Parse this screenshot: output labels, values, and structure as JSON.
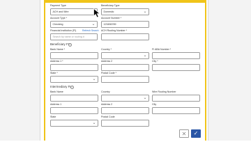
{
  "payment": {
    "payment_type": {
      "label": "Payment Type",
      "value": "ACH and Wire"
    },
    "beneficiary_type": {
      "label": "Beneficiary Type",
      "value": "Domestic"
    },
    "account_type": {
      "label": "Account Type *",
      "value": "Checking"
    },
    "account_number": {
      "label": "Account Number *",
      "value": "123456789"
    },
    "financial_institution": {
      "label": "Financial Institution (FI)",
      "placeholder": "Search by name or routing #",
      "refresh_label": "Refresh Search"
    },
    "ach_routing": {
      "label": "ACH Routing Number *",
      "value": ""
    }
  },
  "beneficiary_fi": {
    "title": "Beneficiary FI",
    "bank_name": "Bank Name *",
    "country": "Country *",
    "fi_aba": "FI ABA Number *",
    "address1": "Address 1 *",
    "address2": "Address 2",
    "city": "City *",
    "state": "State *",
    "postal_code": "Postal Code *"
  },
  "intermediary_fi": {
    "title": "Intermediary FI",
    "bank_name": "Bank Name",
    "country": "Country",
    "wire_routing": "Wire Routing Number",
    "address1": "Address 1",
    "address2": "Address 2",
    "city": "City",
    "state": "State",
    "postal_code": "Postal Code"
  },
  "icons": {
    "help": "?",
    "chevron": "⌄",
    "cancel": "✕",
    "confirm": "✓"
  },
  "colors": {
    "accent_border": "#f0c419",
    "primary_button": "#2a56a6",
    "link": "#2a6fc9"
  }
}
